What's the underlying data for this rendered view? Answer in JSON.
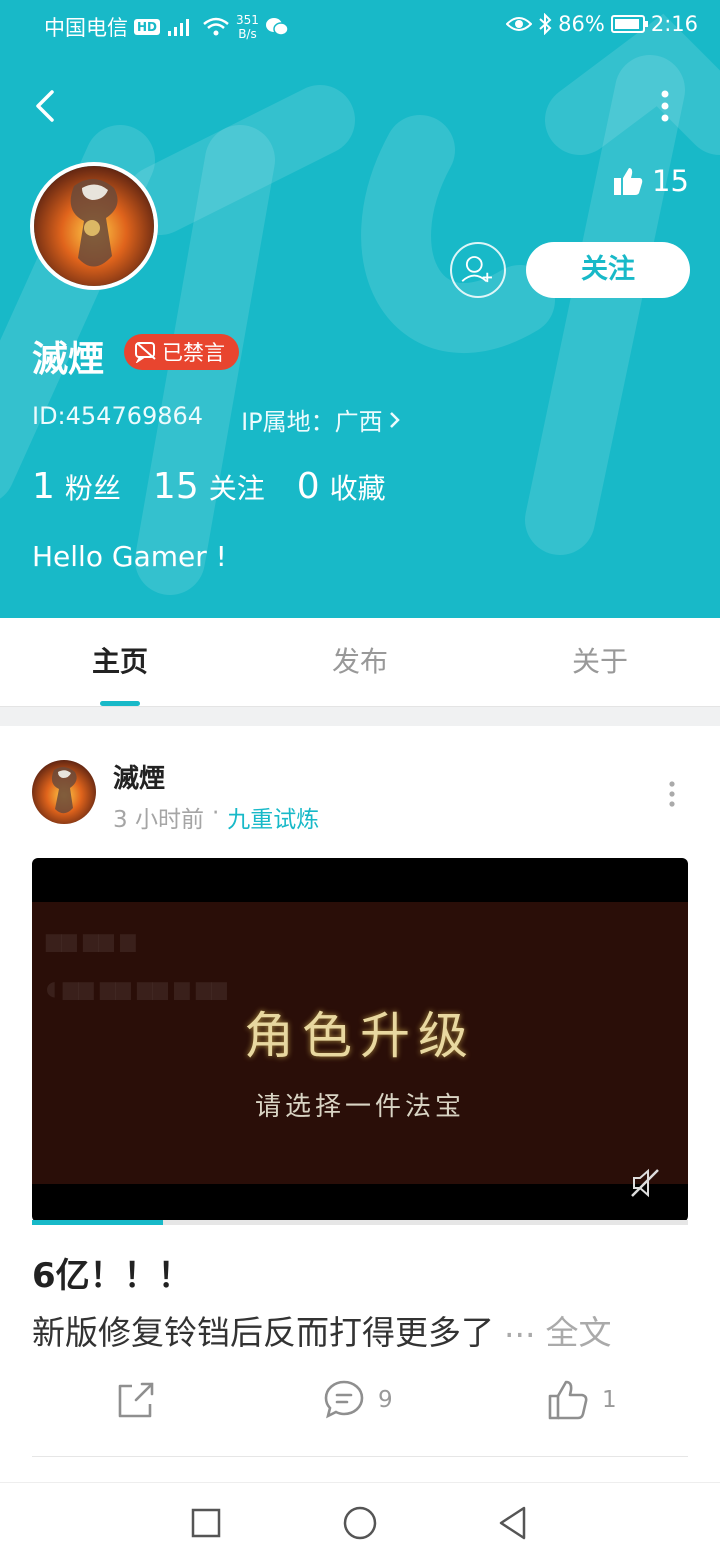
{
  "status_bar": {
    "carrier": "中国电信",
    "hd": "HD",
    "net_speed_value": "351",
    "net_speed_unit": "B/s",
    "battery": "86%",
    "time": "2:16"
  },
  "profile": {
    "name": "滅煙",
    "banned_badge": "已禁言",
    "id_text": "ID:454769864",
    "ip_text": "IP属地：广西",
    "likes": "15",
    "follow_label": "关注",
    "stats": {
      "fans_count": "1",
      "fans_label": "粉丝",
      "following_count": "15",
      "following_label": "关注",
      "favorites_count": "0",
      "favorites_label": "收藏"
    },
    "bio": "Hello Gamer !"
  },
  "tabs": [
    "主页",
    "发布",
    "关于"
  ],
  "active_tab": 0,
  "post": {
    "author": "滅煙",
    "time": "3 小时前",
    "dot": "·",
    "topic": "九重试炼",
    "video_title": "角色升级",
    "video_subtitle": "请选择一件法宝",
    "video_progress": 0.2,
    "title": "6亿！！！",
    "body": "新版修复铃铛后反而打得更多了",
    "ellipsis": "...",
    "read_more": "全文",
    "comments": "9",
    "likes": "1"
  },
  "colors": {
    "accent": "#18b9c8",
    "badge_red": "#e8452f"
  },
  "icons": [
    "back-arrow-icon",
    "more-vertical-icon",
    "thumbs-up-icon",
    "add-friend-icon",
    "mute-icon",
    "share-icon",
    "comment-icon",
    "like-icon",
    "nav-recents-icon",
    "nav-home-icon",
    "nav-back-icon"
  ]
}
